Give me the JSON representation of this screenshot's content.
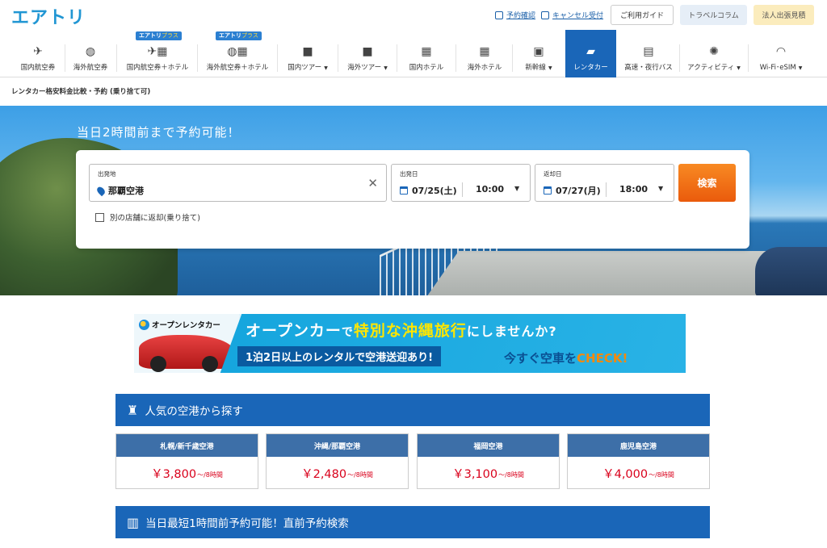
{
  "header": {
    "logo": "エアトリ",
    "links": {
      "reservation_check": "予約確認",
      "cancel": "キャンセル受付"
    },
    "buttons": {
      "guide": "ご利用ガイド",
      "column": "トラベルコラム",
      "corporate": "法人出張見積"
    }
  },
  "nav": {
    "plus_badge_prefix": "エアトリ",
    "plus_badge_suffix": "プラス",
    "items": [
      {
        "label": "国内航空券",
        "icon": "airplane-icon"
      },
      {
        "label": "海外航空券",
        "icon": "globe-plane-icon"
      },
      {
        "label": "国内航空券＋ホテル",
        "icon": "plane-hotel-icon"
      },
      {
        "label": "海外航空券＋ホテル",
        "icon": "globe-hotel-icon"
      },
      {
        "label": "国内ツアー",
        "icon": "suitcase-icon"
      },
      {
        "label": "海外ツアー",
        "icon": "suitcase-icon"
      },
      {
        "label": "国内ホテル",
        "icon": "building-icon"
      },
      {
        "label": "海外ホテル",
        "icon": "building-icon"
      },
      {
        "label": "新幹線",
        "icon": "train-icon"
      },
      {
        "label": "レンタカー",
        "icon": "car-icon"
      },
      {
        "label": "高速・夜行バス",
        "icon": "bus-icon"
      },
      {
        "label": "アクティビティ",
        "icon": "activity-icon"
      },
      {
        "label": "Wi-Fi･eSIM",
        "icon": "wifi-icon"
      }
    ]
  },
  "breadcrumb": "レンタカー格安料金比較・予約 (乗り捨て可)",
  "hero": {
    "title": "当日2時間前まで予約可能！",
    "search": {
      "pickup_label": "出発地",
      "pickup_value": "那覇空港",
      "depart_label": "出発日",
      "depart_date": "07/25(土)",
      "depart_time": "10:00",
      "return_label": "返却日",
      "return_date": "07/27(月)",
      "return_time": "18:00",
      "search_button": "検索",
      "dropoff_checkbox": "別の店舗に返却(乗り捨て)"
    }
  },
  "banner": {
    "brand": "オープンレンタカー",
    "headline_1": "オープンカー",
    "headline_2": "で",
    "headline_3": "特別な沖縄旅行",
    "headline_4": "にしませんか?",
    "sub": "1泊2日以上のレンタルで空港送迎あり!",
    "cta_1": "今すぐ空車を",
    "cta_2": "CHECK!"
  },
  "airports": {
    "title": "人気の空港から探す",
    "unit": "～/8時間",
    "items": [
      {
        "name": "札幌/新千歳空港",
        "price": "￥3,800"
      },
      {
        "name": "沖縄/那覇空港",
        "price": "￥2,480"
      },
      {
        "name": "福岡空港",
        "price": "￥3,100"
      },
      {
        "name": "鹿児島空港",
        "price": "￥4,000"
      }
    ]
  },
  "last_minute": {
    "title": "当日最短1時間前予約可能！直前予約検索"
  }
}
